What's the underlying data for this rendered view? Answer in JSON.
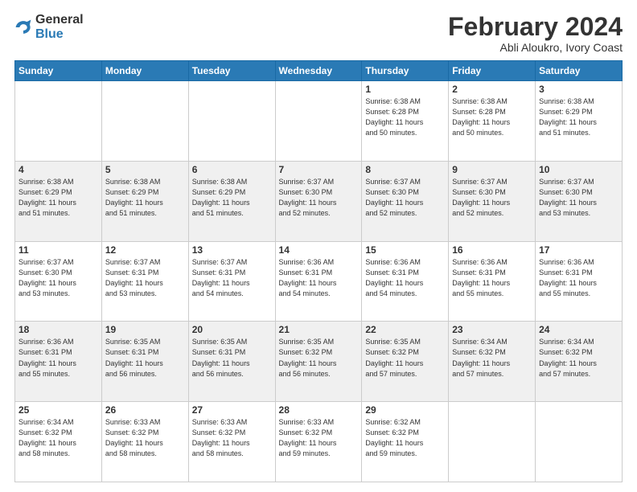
{
  "logo": {
    "general": "General",
    "blue": "Blue"
  },
  "title": "February 2024",
  "subtitle": "Abli Aloukro, Ivory Coast",
  "days_header": [
    "Sunday",
    "Monday",
    "Tuesday",
    "Wednesday",
    "Thursday",
    "Friday",
    "Saturday"
  ],
  "weeks": [
    [
      {
        "day": "",
        "info": ""
      },
      {
        "day": "",
        "info": ""
      },
      {
        "day": "",
        "info": ""
      },
      {
        "day": "",
        "info": ""
      },
      {
        "day": "1",
        "info": "Sunrise: 6:38 AM\nSunset: 6:28 PM\nDaylight: 11 hours\nand 50 minutes."
      },
      {
        "day": "2",
        "info": "Sunrise: 6:38 AM\nSunset: 6:28 PM\nDaylight: 11 hours\nand 50 minutes."
      },
      {
        "day": "3",
        "info": "Sunrise: 6:38 AM\nSunset: 6:29 PM\nDaylight: 11 hours\nand 51 minutes."
      }
    ],
    [
      {
        "day": "4",
        "info": "Sunrise: 6:38 AM\nSunset: 6:29 PM\nDaylight: 11 hours\nand 51 minutes."
      },
      {
        "day": "5",
        "info": "Sunrise: 6:38 AM\nSunset: 6:29 PM\nDaylight: 11 hours\nand 51 minutes."
      },
      {
        "day": "6",
        "info": "Sunrise: 6:38 AM\nSunset: 6:29 PM\nDaylight: 11 hours\nand 51 minutes."
      },
      {
        "day": "7",
        "info": "Sunrise: 6:37 AM\nSunset: 6:30 PM\nDaylight: 11 hours\nand 52 minutes."
      },
      {
        "day": "8",
        "info": "Sunrise: 6:37 AM\nSunset: 6:30 PM\nDaylight: 11 hours\nand 52 minutes."
      },
      {
        "day": "9",
        "info": "Sunrise: 6:37 AM\nSunset: 6:30 PM\nDaylight: 11 hours\nand 52 minutes."
      },
      {
        "day": "10",
        "info": "Sunrise: 6:37 AM\nSunset: 6:30 PM\nDaylight: 11 hours\nand 53 minutes."
      }
    ],
    [
      {
        "day": "11",
        "info": "Sunrise: 6:37 AM\nSunset: 6:30 PM\nDaylight: 11 hours\nand 53 minutes."
      },
      {
        "day": "12",
        "info": "Sunrise: 6:37 AM\nSunset: 6:31 PM\nDaylight: 11 hours\nand 53 minutes."
      },
      {
        "day": "13",
        "info": "Sunrise: 6:37 AM\nSunset: 6:31 PM\nDaylight: 11 hours\nand 54 minutes."
      },
      {
        "day": "14",
        "info": "Sunrise: 6:36 AM\nSunset: 6:31 PM\nDaylight: 11 hours\nand 54 minutes."
      },
      {
        "day": "15",
        "info": "Sunrise: 6:36 AM\nSunset: 6:31 PM\nDaylight: 11 hours\nand 54 minutes."
      },
      {
        "day": "16",
        "info": "Sunrise: 6:36 AM\nSunset: 6:31 PM\nDaylight: 11 hours\nand 55 minutes."
      },
      {
        "day": "17",
        "info": "Sunrise: 6:36 AM\nSunset: 6:31 PM\nDaylight: 11 hours\nand 55 minutes."
      }
    ],
    [
      {
        "day": "18",
        "info": "Sunrise: 6:36 AM\nSunset: 6:31 PM\nDaylight: 11 hours\nand 55 minutes."
      },
      {
        "day": "19",
        "info": "Sunrise: 6:35 AM\nSunset: 6:31 PM\nDaylight: 11 hours\nand 56 minutes."
      },
      {
        "day": "20",
        "info": "Sunrise: 6:35 AM\nSunset: 6:31 PM\nDaylight: 11 hours\nand 56 minutes."
      },
      {
        "day": "21",
        "info": "Sunrise: 6:35 AM\nSunset: 6:32 PM\nDaylight: 11 hours\nand 56 minutes."
      },
      {
        "day": "22",
        "info": "Sunrise: 6:35 AM\nSunset: 6:32 PM\nDaylight: 11 hours\nand 57 minutes."
      },
      {
        "day": "23",
        "info": "Sunrise: 6:34 AM\nSunset: 6:32 PM\nDaylight: 11 hours\nand 57 minutes."
      },
      {
        "day": "24",
        "info": "Sunrise: 6:34 AM\nSunset: 6:32 PM\nDaylight: 11 hours\nand 57 minutes."
      }
    ],
    [
      {
        "day": "25",
        "info": "Sunrise: 6:34 AM\nSunset: 6:32 PM\nDaylight: 11 hours\nand 58 minutes."
      },
      {
        "day": "26",
        "info": "Sunrise: 6:33 AM\nSunset: 6:32 PM\nDaylight: 11 hours\nand 58 minutes."
      },
      {
        "day": "27",
        "info": "Sunrise: 6:33 AM\nSunset: 6:32 PM\nDaylight: 11 hours\nand 58 minutes."
      },
      {
        "day": "28",
        "info": "Sunrise: 6:33 AM\nSunset: 6:32 PM\nDaylight: 11 hours\nand 59 minutes."
      },
      {
        "day": "29",
        "info": "Sunrise: 6:32 AM\nSunset: 6:32 PM\nDaylight: 11 hours\nand 59 minutes."
      },
      {
        "day": "",
        "info": ""
      },
      {
        "day": "",
        "info": ""
      }
    ]
  ]
}
